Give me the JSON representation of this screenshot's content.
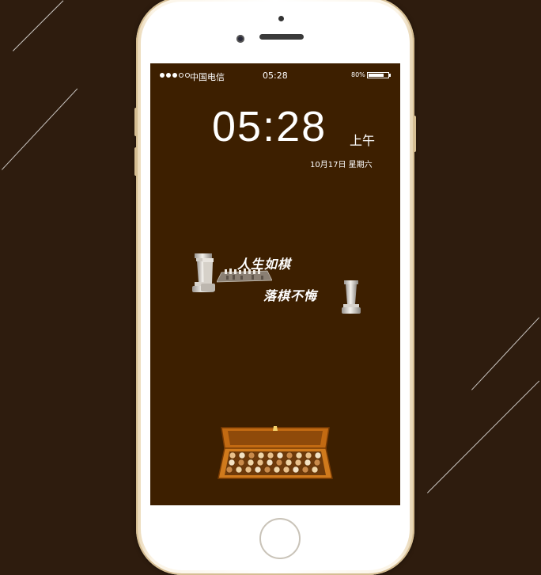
{
  "status_bar": {
    "signal_dots": [
      true,
      true,
      true,
      false,
      false
    ],
    "carrier": "中国电信",
    "time": "05:28",
    "battery_percent_label": "80%",
    "battery_level": 0.8
  },
  "lock_screen": {
    "time": "05:28",
    "ampm": "上午",
    "date": "10月17日 星期六"
  },
  "wallpaper": {
    "slogan_line_1": "人生如棋",
    "slogan_line_2": "落棋不悔"
  },
  "colors": {
    "background": "#2e1c0e",
    "screen": "#3d1f00",
    "phone_body": "#ffffff",
    "phone_trim": "#d6be93",
    "chest": "#c26a12"
  },
  "icons": [
    "chess-rook-icon",
    "chessboard-icon",
    "chess-box-icon"
  ]
}
